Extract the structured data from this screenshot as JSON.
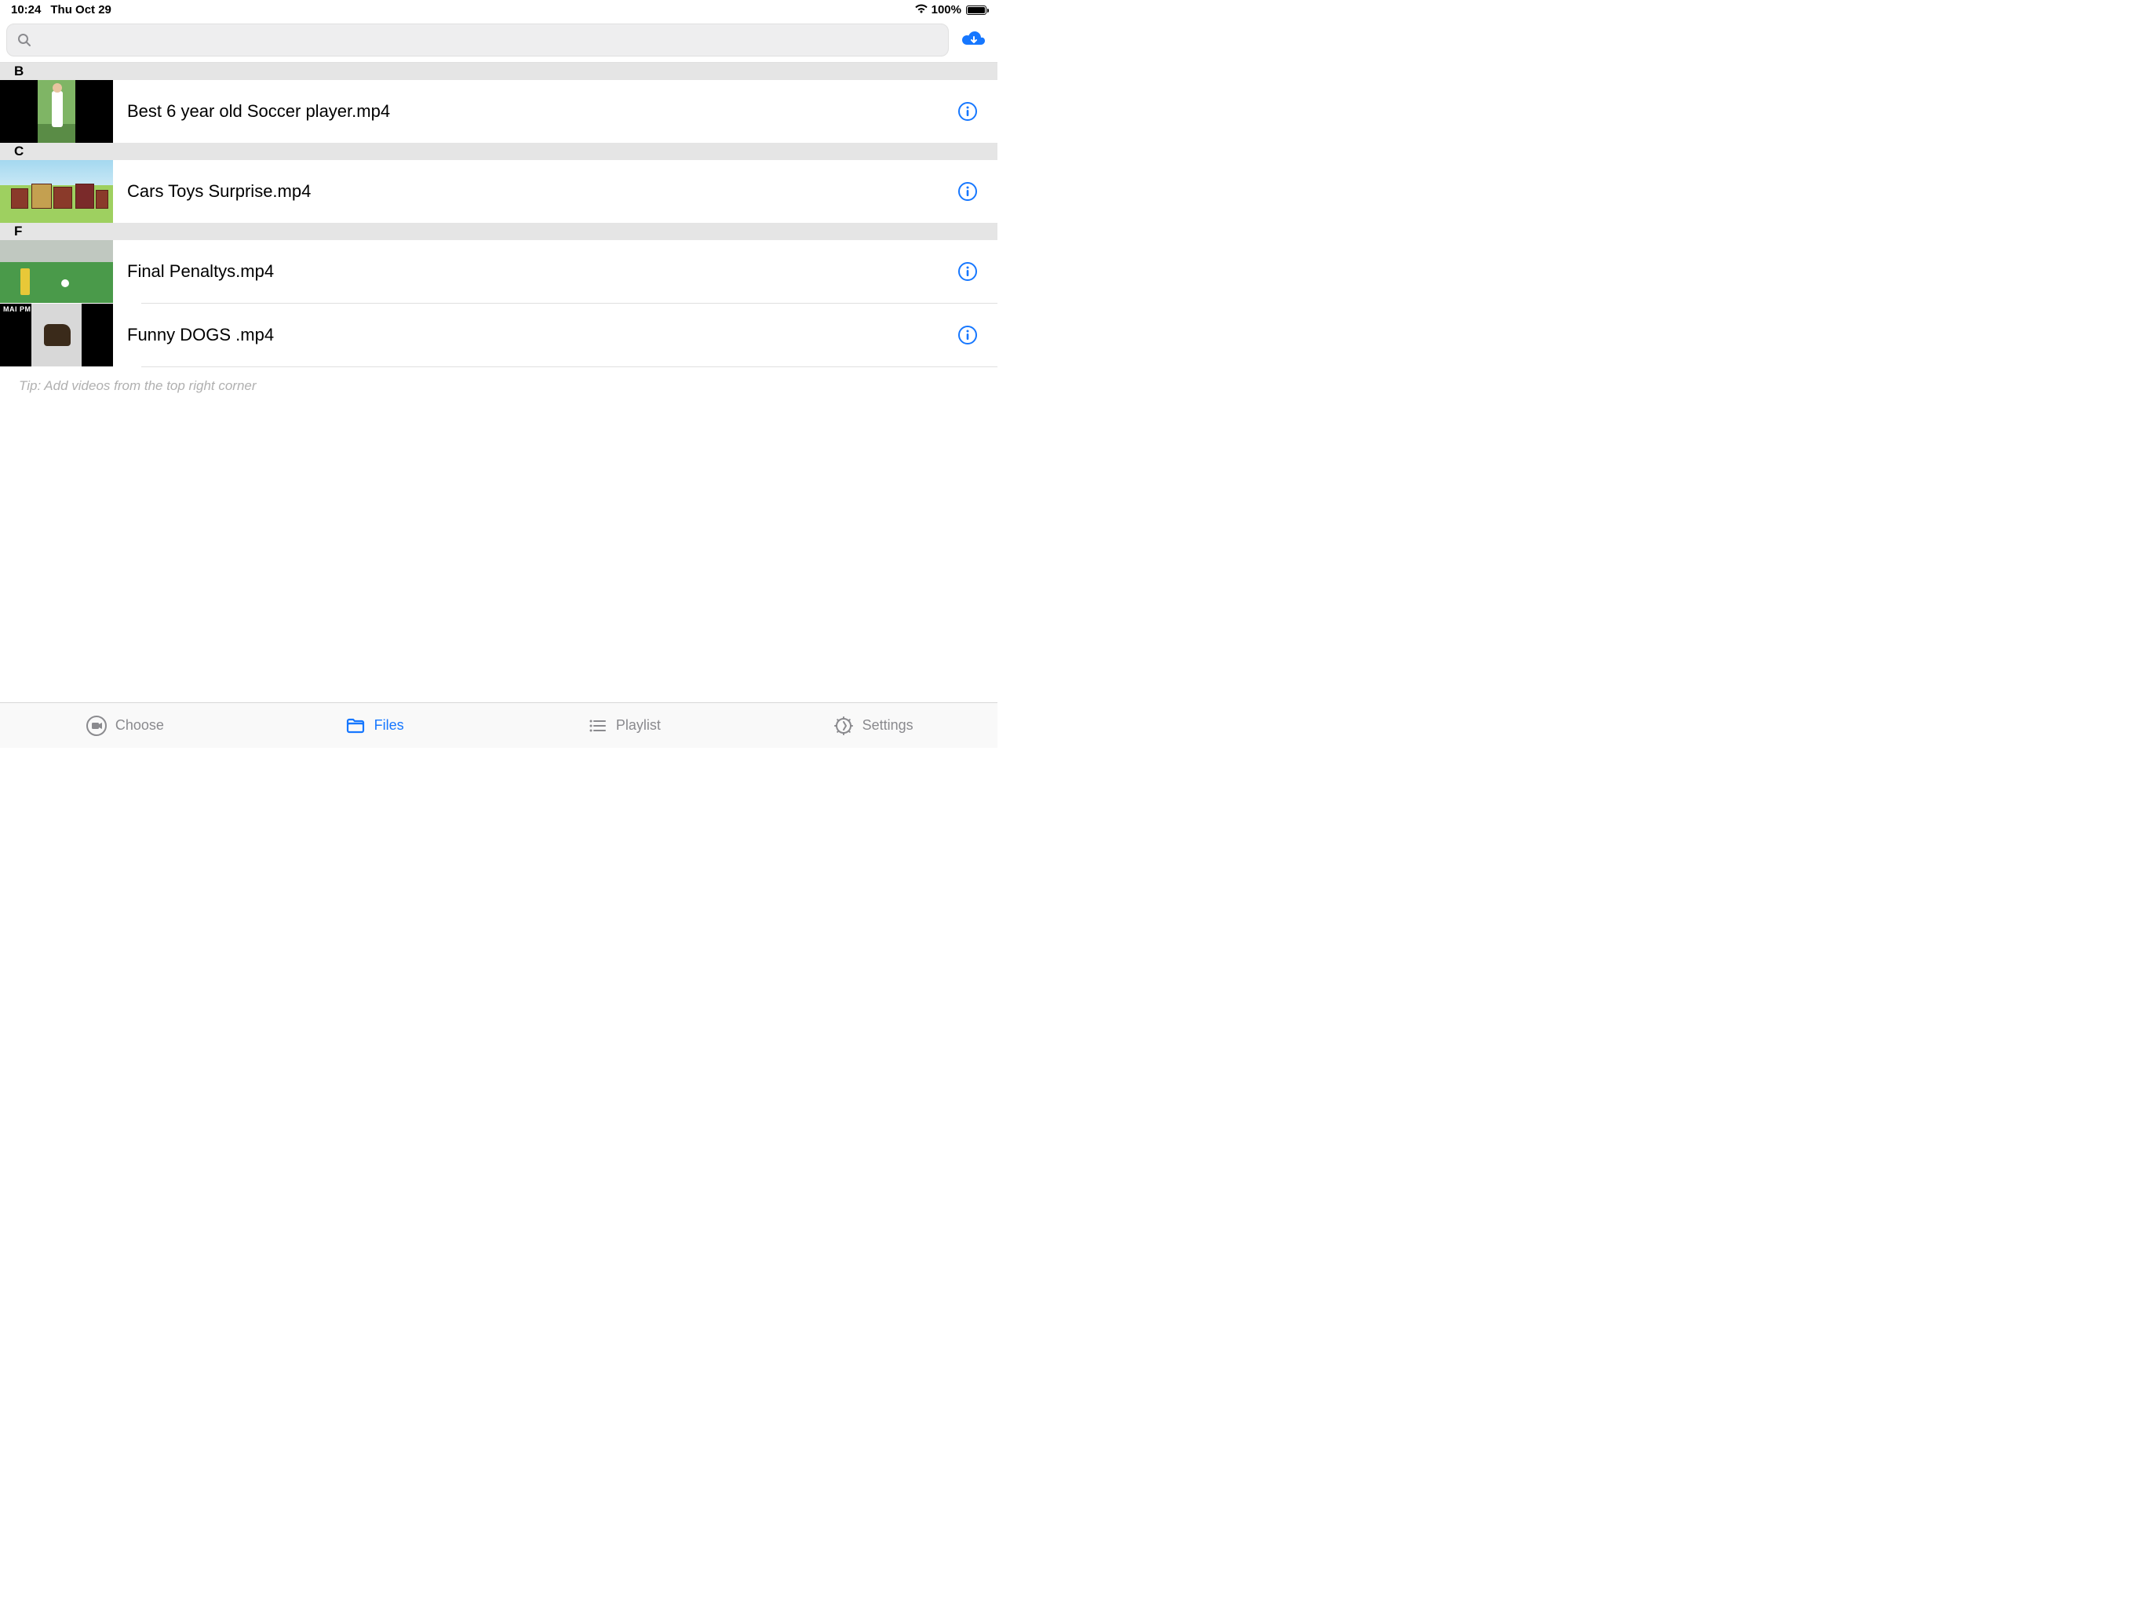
{
  "status": {
    "time": "10:24",
    "date": "Thu Oct 29",
    "battery_pct": "100%"
  },
  "search": {
    "placeholder": ""
  },
  "sections": [
    {
      "letter": "B",
      "items": [
        {
          "title": "Best 6 year old Soccer player.mp4",
          "thumb": "soccer-kid"
        }
      ]
    },
    {
      "letter": "C",
      "items": [
        {
          "title": "Cars Toys Surprise.mp4",
          "thumb": "toys"
        }
      ]
    },
    {
      "letter": "F",
      "items": [
        {
          "title": "Final Penaltys.mp4",
          "thumb": "penalty"
        },
        {
          "title": "Funny DOGS .mp4",
          "thumb": "dog"
        }
      ]
    }
  ],
  "tip": "Tip: Add videos from the top right corner",
  "tabs": {
    "choose": "Choose",
    "files": "Files",
    "playlist": "Playlist",
    "settings": "Settings"
  },
  "thumb4_label": "MAI PM"
}
